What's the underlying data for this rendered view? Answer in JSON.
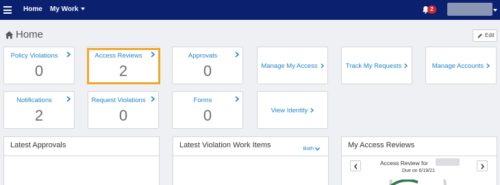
{
  "nav": {
    "home": "Home",
    "my_work": "My Work",
    "notification_count": "2"
  },
  "page": {
    "title": "Home",
    "edit_label": "Edit"
  },
  "tiles_row1": [
    {
      "label": "Policy Violations",
      "count": "0"
    },
    {
      "label": "Access Reviews",
      "count": "2"
    },
    {
      "label": "Approvals",
      "count": "0"
    }
  ],
  "links_row1": [
    {
      "label": "Manage My Access"
    },
    {
      "label": "Track My Requests"
    },
    {
      "label": "Manage Accounts"
    }
  ],
  "tiles_row2": [
    {
      "label": "Notifications",
      "count": "2"
    },
    {
      "label": "Request Violations",
      "count": "0"
    },
    {
      "label": "Forms",
      "count": "0"
    }
  ],
  "links_row2": [
    {
      "label": "View Identity"
    }
  ],
  "panels": {
    "latest_approvals": {
      "title": "Latest Approvals"
    },
    "latest_violation": {
      "title": "Latest Violation Work Items",
      "filter": "Both"
    },
    "my_access_reviews": {
      "title": "My Access Reviews",
      "review_title": "Access Review for",
      "due": "Due on 6/19/21"
    }
  },
  "colors": {
    "nav_bg": "#0b2170",
    "link": "#1e84c6",
    "highlight": "#f1a629",
    "badge": "#d9242b"
  },
  "icons": [
    "hamburger-icon",
    "bell-icon",
    "home-icon",
    "pencil-icon",
    "chevron-right-icon",
    "chevron-left-icon",
    "chevron-down-icon"
  ]
}
